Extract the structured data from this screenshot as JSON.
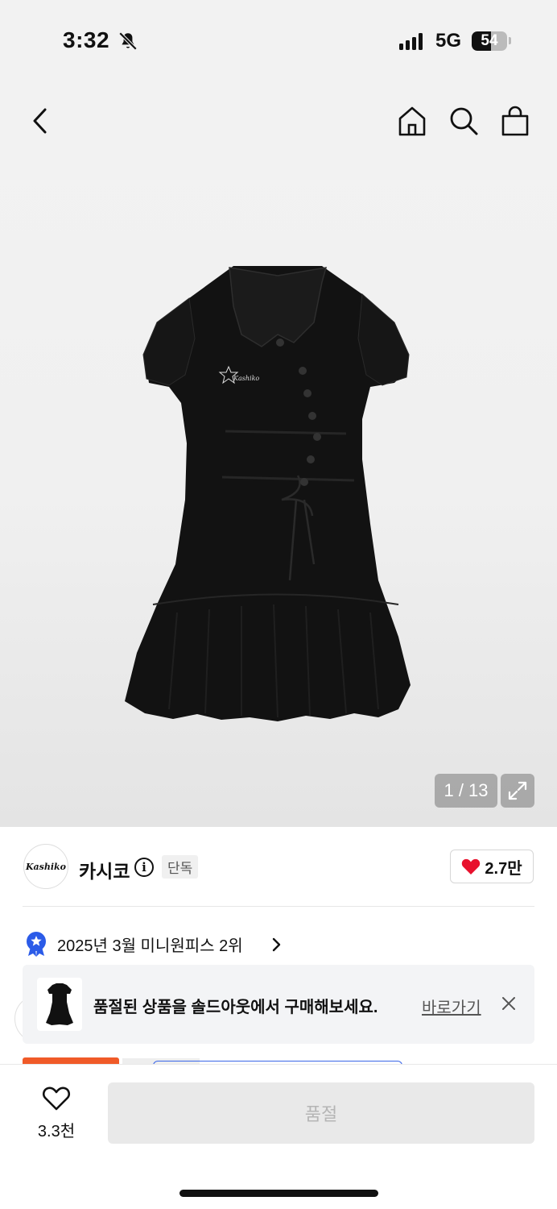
{
  "status_bar": {
    "time": "3:32",
    "network": "5G",
    "battery": "54",
    "battery_level": 0.54,
    "icons": [
      "bell-slash-icon",
      "signal-icon",
      "battery-icon"
    ]
  },
  "header": {
    "icons": [
      "back-icon",
      "home-icon",
      "search-icon",
      "shopping-bag-icon"
    ]
  },
  "gallery": {
    "counter": "1 / 13",
    "image": "black-puff-sleeve-mini-dress",
    "print_on_dress": "Kashiko",
    "expand_icon": "expand-icon"
  },
  "brand": {
    "logo_text": "Kashiko",
    "name": "카시코",
    "info_icon_text": "i",
    "badge": "단독",
    "likes": "2.7만",
    "heart_color": "#e8112d"
  },
  "ranking": {
    "text": "2025년 3월 미니원피스 2위",
    "badge_color": "#2b5be8",
    "icon": "rank-badge-icon"
  },
  "soldout_banner": {
    "message": "품절된 상품을 솔드아웃에서 구매해보세요.",
    "link": "바로가기",
    "close_icon": "close-icon"
  },
  "bottom_bar": {
    "wishlist_count": "3.3천",
    "buy_button": "품절",
    "accent_orange": "#f05a28"
  }
}
